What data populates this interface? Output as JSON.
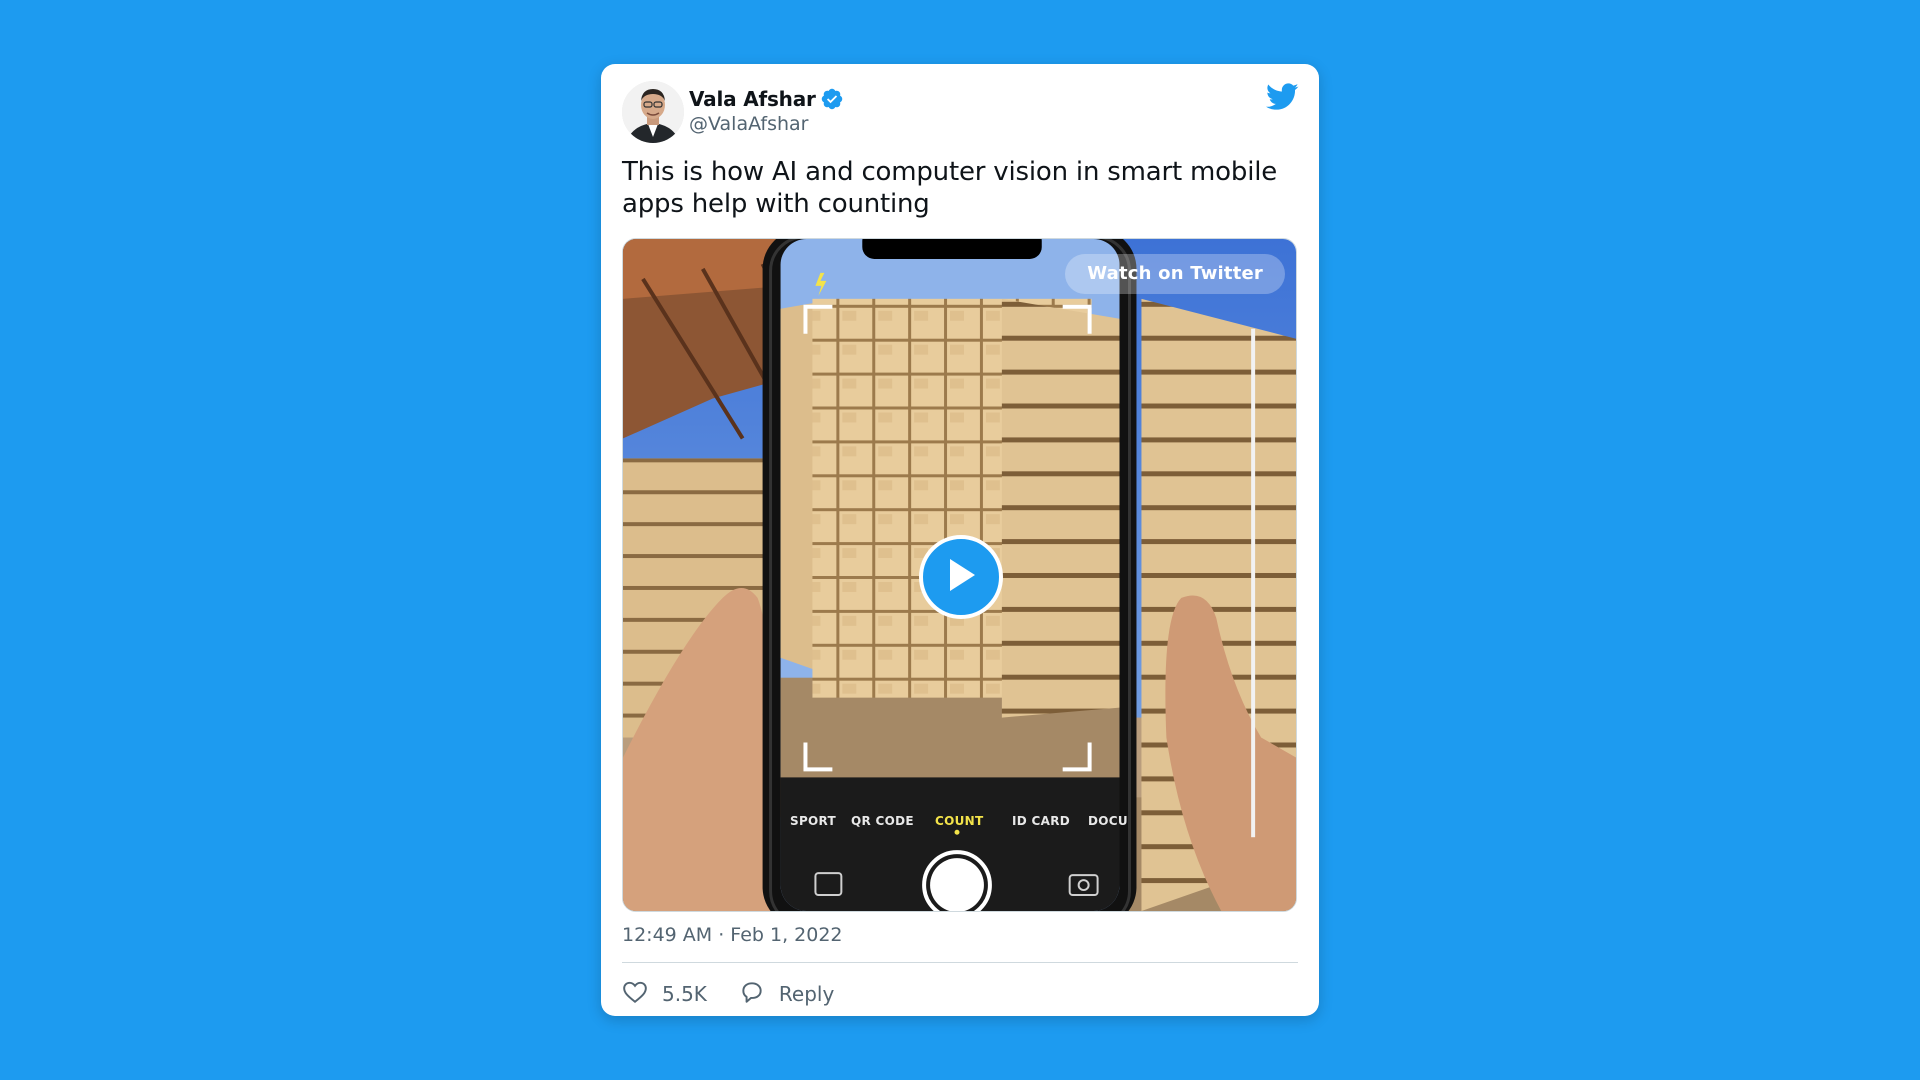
{
  "tweet": {
    "display_name": "Vala Afshar",
    "handle": "@ValaAfshar",
    "text": "This is how AI and computer vision in smart mobile apps help with counting",
    "timestamp": "12:49 AM · Feb 1, 2022",
    "verified": true
  },
  "media": {
    "watch_label": "Watch on Twitter",
    "camera_modes": [
      "SPORT",
      "QR CODE",
      "COUNT",
      "ID CARD",
      "DOCU"
    ],
    "active_mode": "COUNT"
  },
  "actions": {
    "likes": "5.5K",
    "reply_label": "Reply"
  },
  "icons": {
    "brand": "twitter-bird-icon",
    "verified": "verified-badge-icon",
    "like": "heart-icon",
    "reply": "speech-bubble-icon",
    "play": "play-icon"
  },
  "colors": {
    "background": "#1d9bf0",
    "accent": "#1d9bf0",
    "text": "#0f1419",
    "secondary_text": "#536471",
    "active_mode": "#f3e34a"
  }
}
